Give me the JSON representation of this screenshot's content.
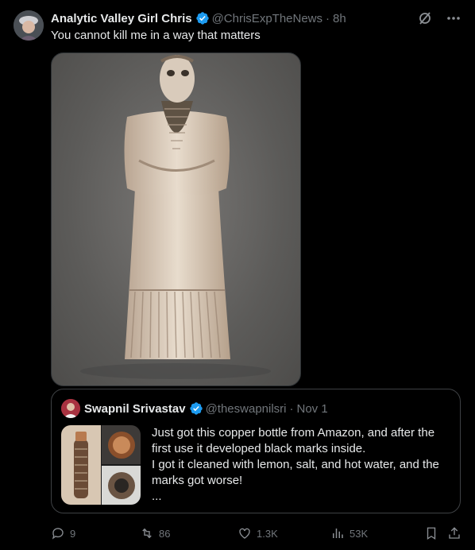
{
  "tweet": {
    "author_name": "Analytic Valley Girl Chris",
    "handle": "@ChrisExpTheNews",
    "time": "8h",
    "separator": "·",
    "text": "You cannot kill me in a way that matters"
  },
  "quote": {
    "author_name": "Swapnil Srivastav",
    "handle": "@theswapnilsri",
    "time": "Nov 1",
    "separator": "·",
    "lines": [
      "Just got this copper bottle from Amazon, and after the first use it developed black marks inside.",
      "I got it cleaned with lemon, salt, and hot water, and the marks got worse!",
      "..."
    ]
  },
  "actions": {
    "replies": "9",
    "reposts": "86",
    "likes": "1.3K",
    "views": "53K"
  },
  "icons": {
    "header": [
      "verified-badge-icon",
      "grok-icon",
      "more-icon"
    ],
    "actions": [
      "reply-icon",
      "repost-icon",
      "like-icon",
      "views-icon",
      "bookmark-icon",
      "share-icon"
    ]
  },
  "colors": {
    "background": "#000000",
    "text": "#e7e9ea",
    "muted": "#71767b",
    "verified": "#1d9bf0",
    "border": "#2f3336"
  }
}
